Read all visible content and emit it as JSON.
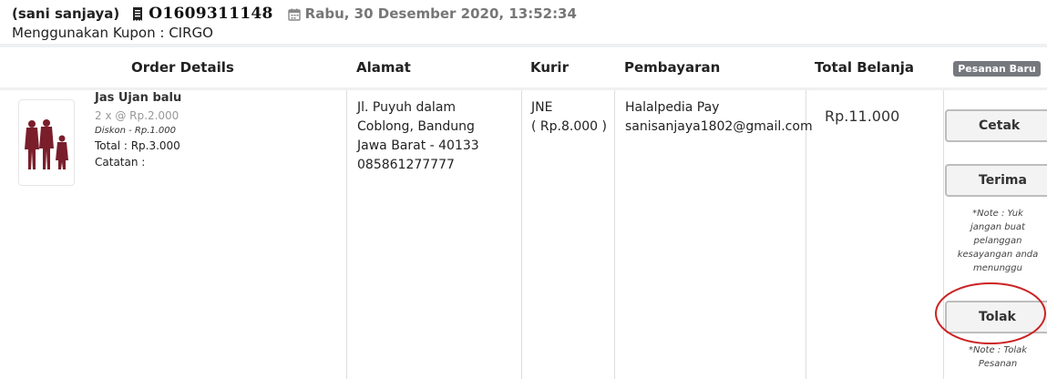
{
  "header": {
    "customer": "(sani sanjaya)",
    "order_no": "O1609311148",
    "datetime": "Rabu, 30 Desember 2020, 13:52:34",
    "coupon": "Menggunakan Kupon : CIRGO"
  },
  "table": {
    "headers": {
      "order_details": "Order Details",
      "alamat": "Alamat",
      "kurir": "Kurir",
      "pembayaran": "Pembayaran",
      "total_belanja": "Total Belanja",
      "status_badge": "Pesanan Baru"
    }
  },
  "order": {
    "product": {
      "name": "Jas Ujan balu",
      "qty_price": "2 x @ Rp.2.000",
      "discount": "Diskon - Rp.1.000",
      "total": "Total : Rp.3.000",
      "note": "Catatan :"
    },
    "address": [
      "Jl. Puyuh dalam",
      "Coblong, Bandung",
      "Jawa Barat - 40133",
      "085861277777"
    ],
    "courier": [
      "JNE",
      "( Rp.8.000 )"
    ],
    "payment": [
      "Halalpedia Pay",
      "sanisanjaya1802@gmail.com"
    ],
    "total": "Rp.11.000"
  },
  "actions": {
    "cetak": "Cetak",
    "terima": "Terima",
    "terima_note": "*Note : Yuk jangan buat pelanggan kesayangan anda menunggu",
    "tolak": "Tolak",
    "tolak_note": "*Note : Tolak Pesanan"
  },
  "icons": {
    "invoice": "receipt-icon",
    "date": "calendar-icon"
  },
  "colors": {
    "highlight_circle": "#cc2222",
    "badge_bg": "#75797e",
    "datetime_text": "#777777"
  }
}
